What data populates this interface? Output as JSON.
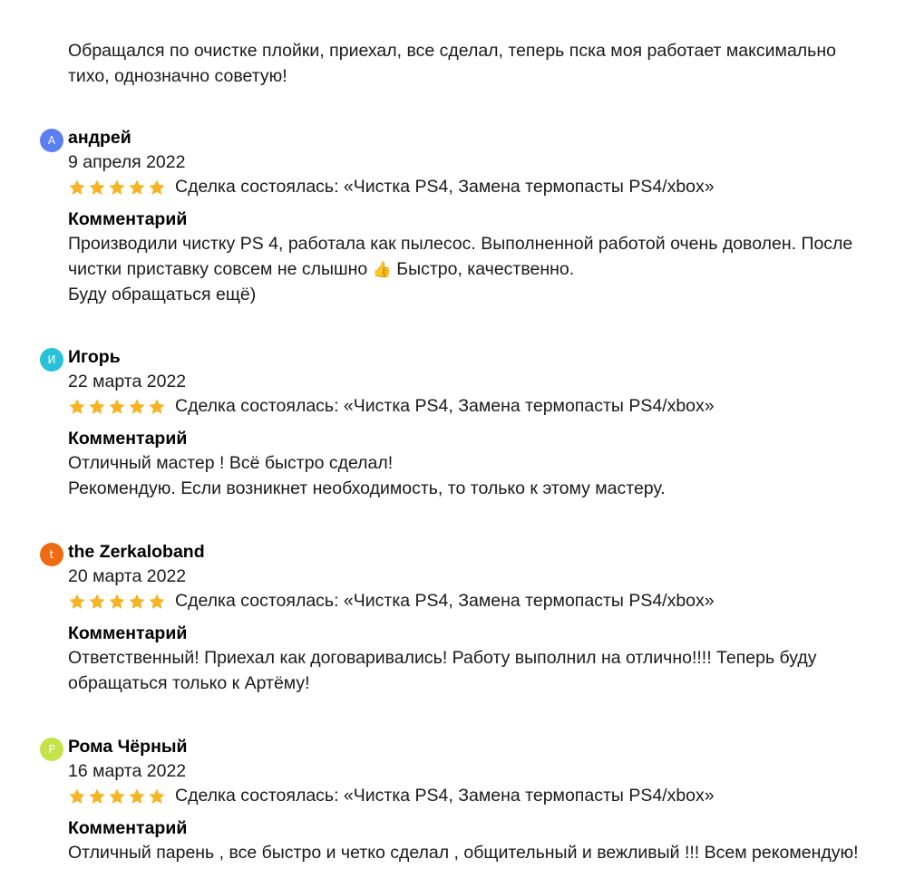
{
  "top_comment": {
    "lines": [
      "Обращался по очистке плойки, приехал, все сделал, теперь пска моя работает максимально",
      "тихо, однозначно советую!"
    ]
  },
  "colors": {
    "star": "#f5b423",
    "avatar_andrey": "#5b7ff0",
    "avatar_igor": "#27c2d8",
    "avatar_zerkaloband": "#ef6a12",
    "avatar_roma": "#c4e24a"
  },
  "icons": {
    "star": "star-icon",
    "thumb": "thumbs-up-icon"
  },
  "reviews": [
    {
      "avatar_letter": "А",
      "author": "андрей",
      "date": "9 апреля 2022",
      "rating": 5,
      "deal": "Сделка состоялась: «Чистка PS4, Замена термопасты PS4/xbox»",
      "comment_label": "Комментарий",
      "comment_lines": [
        "Производили чистку PS 4, работала как пылесос. Выполненной работой очень доволен. После",
        "чистки приставку совсем не слышно",
        "Буду обращаться ещё)"
      ],
      "comment_line2_suffix": " Быстро, качественно.",
      "thumb_emoji": "👍"
    },
    {
      "avatar_letter": "И",
      "author": "Игорь",
      "date": "22 марта 2022",
      "rating": 5,
      "deal": "Сделка состоялась: «Чистка PS4, Замена термопасты PS4/xbox»",
      "comment_label": "Комментарий",
      "comment_lines": [
        "Отличный мастер ! Всё быстро сделал!",
        "Рекомендую. Если возникнет необходимость, то только к этому мастеру."
      ]
    },
    {
      "avatar_letter": "t",
      "author": "the Zerkaloband",
      "date": "20 марта 2022",
      "rating": 5,
      "deal": "Сделка состоялась: «Чистка PS4, Замена термопасты PS4/xbox»",
      "comment_label": "Комментарий",
      "comment_lines": [
        "Ответственный! Приехал как договаривались! Работу выполнил на отлично!!!! Теперь буду",
        "обращаться только к Артёму!"
      ]
    },
    {
      "avatar_letter": "Р",
      "author": "Рома Чёрный",
      "date": "16 марта 2022",
      "rating": 5,
      "deal": "Сделка состоялась: «Чистка PS4, Замена термопасты PS4/xbox»",
      "comment_label": "Комментарий",
      "comment_lines": [
        "Отличный парень , все быстро и четко сделал , общительный и вежливый !!! Всем рекомендую!"
      ]
    }
  ]
}
